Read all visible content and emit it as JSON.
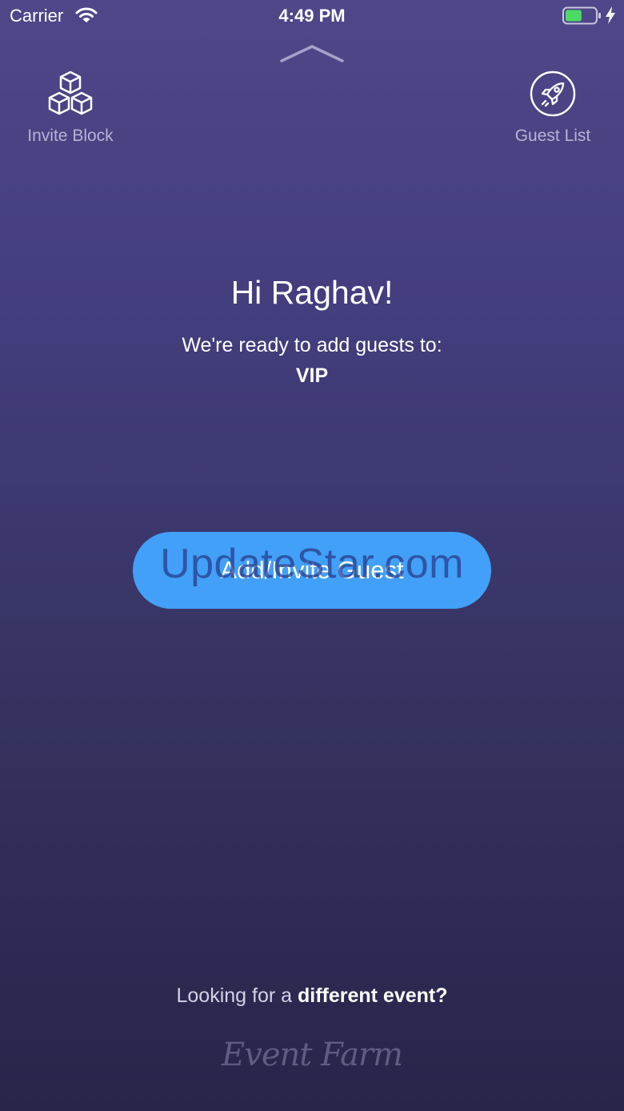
{
  "status_bar": {
    "carrier": "Carrier",
    "time": "4:49 PM",
    "battery_level_fraction": 0.55,
    "battery_color": "#4cd964"
  },
  "nav": {
    "left": {
      "label": "Invite Block",
      "icon": "cubes-icon"
    },
    "right": {
      "label": "Guest List",
      "icon": "rocket-icon"
    }
  },
  "main": {
    "greeting": "Hi Raghav!",
    "ready_text": "We're ready to add guests to:",
    "list_name": "VIP",
    "add_button_label": "Add/Invite Guest"
  },
  "watermark": "UpdateStar.com",
  "footer": {
    "prefix": "Looking for a ",
    "bold": "different event?",
    "brand": "Event Farm"
  },
  "colors": {
    "accent_button": "#42a0f8",
    "bg_top": "#4e4789",
    "bg_bottom": "#27254a"
  }
}
